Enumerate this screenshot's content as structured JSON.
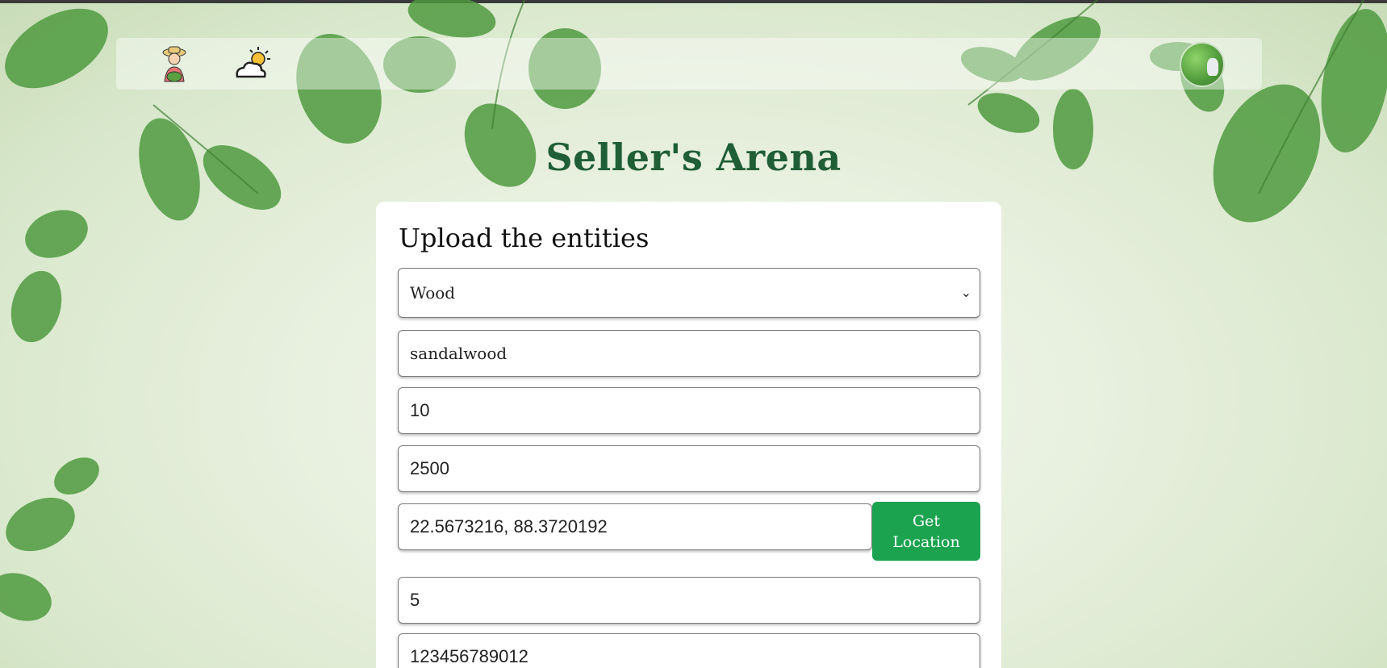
{
  "nav": {
    "icons": [
      "farmer-icon",
      "weather-icon",
      "profile-avatar"
    ]
  },
  "page": {
    "title": "Seller's Arena"
  },
  "form": {
    "heading": "Upload the entities",
    "category": {
      "value": "Wood"
    },
    "name": {
      "value": "sandalwood"
    },
    "quantity": {
      "value": "10"
    },
    "price": {
      "value": "2500"
    },
    "location": {
      "value": "22.5673216, 88.3720192"
    },
    "get_location_label": "Get Location",
    "field6": {
      "value": "5"
    },
    "field7": {
      "value": "123456789012"
    }
  },
  "colors": {
    "title_green": "#1f5e36",
    "button_green": "#1ca350"
  }
}
